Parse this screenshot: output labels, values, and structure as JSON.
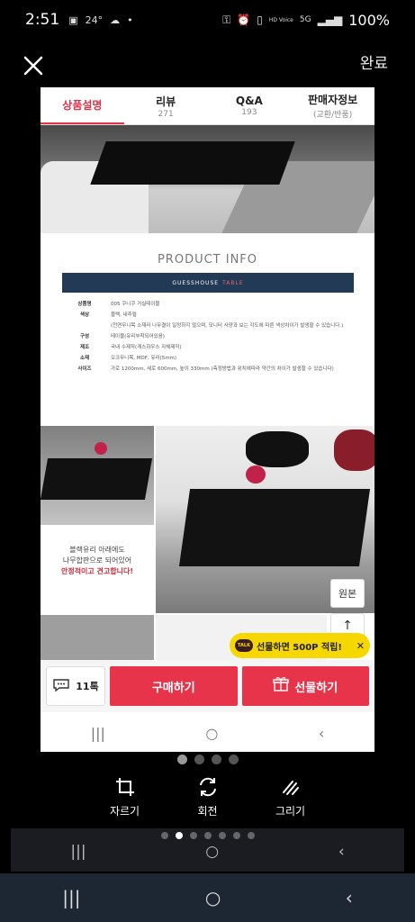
{
  "status": {
    "time": "2:51",
    "left_icons": [
      "image-icon",
      "24°",
      "cloud-icon",
      "•"
    ],
    "right_icons": [
      "key-icon",
      "alarm-icon",
      "vibrate-icon",
      "HD Voice",
      "5G",
      "signal-icon"
    ],
    "battery": "100%"
  },
  "editor": {
    "done_label": "완료"
  },
  "preview": {
    "tabs": [
      {
        "label": "상품설명",
        "sub": ""
      },
      {
        "label": "리뷰",
        "sub": "271"
      },
      {
        "label": "Q&A",
        "sub": "193"
      },
      {
        "label": "판매자정보",
        "sub": "(교환/반품)"
      }
    ],
    "info_title": "PRODUCT INFO",
    "banner_left": "GUESSHOUSE",
    "banner_right": "TABLE",
    "info_rows": [
      {
        "k": "상품명",
        "v": "005 쿠니쿠 거실테이블"
      },
      {
        "k": "색상",
        "v": "블랙, 내추럴"
      },
      {
        "k": "",
        "v": "(천연무니목 소재라 나무결이 일정하지 않으며, 모니터 사양과 보는 각도에 따른 색상차이가 발생할 수 있습니다.)"
      },
      {
        "k": "구성",
        "v": "테이블(유리부착되어있음)"
      },
      {
        "k": "제조",
        "v": "국내 수제작(게스하우스 자체제작)"
      },
      {
        "k": "소재",
        "v": "오크무니목, MDF, 유리(5mm)"
      },
      {
        "k": "사이즈",
        "v": "가로 1200mm, 세로 600mm, 높이 330mm (측정방법과 위치에따라 약간의 차이가 발생할 수 있습니다)"
      }
    ],
    "caption_lines": [
      "블랙유리 아래에도",
      "나무합판으로 되어있어"
    ],
    "caption_red": "안정적이고 견고합니다!",
    "original_label": "원본",
    "up_arrow": "↑",
    "kakao_talk": "TALK",
    "kakao_text": "선물하면 500P 적립!",
    "kakao_close": "✕",
    "chat_count": "11톡",
    "buy_label": "구매하기",
    "gift_label": "선물하기",
    "inner_nav": [
      "|||",
      "○",
      "‹"
    ]
  },
  "tools": [
    {
      "label": "자르기",
      "icon": "crop-icon"
    },
    {
      "label": "회전",
      "icon": "rotate-icon"
    },
    {
      "label": "그리기",
      "icon": "draw-icon"
    }
  ],
  "page_dots_top": {
    "count": 4,
    "active": 0
  },
  "page_dots_bottom": {
    "count": 7,
    "active": 1
  },
  "strip_nav": [
    "|||",
    "○",
    "‹"
  ],
  "system_nav": [
    "|||",
    "○",
    "‹"
  ]
}
